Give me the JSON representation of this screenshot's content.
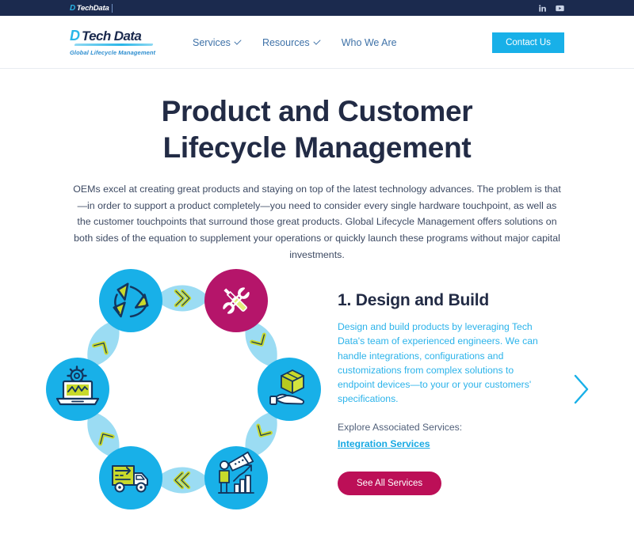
{
  "topbar": {
    "logo_mark": "D",
    "logo_text": "TechData",
    "socials": [
      {
        "name": "linkedin-icon",
        "label": "LinkedIn"
      },
      {
        "name": "youtube-icon",
        "label": "YouTube"
      }
    ]
  },
  "header": {
    "brand_mark": "D",
    "brand_name": "Tech Data",
    "brand_tagline": "Global Lifecycle Management",
    "nav": [
      {
        "label": "Services",
        "has_dropdown": true
      },
      {
        "label": "Resources",
        "has_dropdown": true
      },
      {
        "label": "Who We Are",
        "has_dropdown": false
      }
    ],
    "contact_label": "Contact Us"
  },
  "hero": {
    "title_line1": "Product and Customer",
    "title_line2": "Lifecycle Management",
    "paragraph": "OEMs excel at creating great products and staying on top of the latest technology advances. The problem is that—in order to support a product completely—you need to consider every single hardware touchpoint, as well as the customer touchpoints that surround those great products. Global Lifecycle Management offers solutions on both sides of the equation to supplement your operations or quickly launch these programs without major capital investments."
  },
  "step": {
    "title": "1. Design and Build",
    "body": "Design and build products by leveraging Tech Data's team of experienced engineers. We can handle integrations, configurations and customizations from complex solutions to endpoint devices—to your or your customers' specifications.",
    "explore_label": "Explore Associated Services:",
    "link_label": "Integration Services",
    "see_all_label": "See All Services"
  },
  "cycle": {
    "nodes": [
      {
        "id": "recycle",
        "icon": "recycle-icon",
        "active": false
      },
      {
        "id": "design-build",
        "icon": "tools-icon",
        "active": true
      },
      {
        "id": "deploy",
        "icon": "hand-box-icon",
        "active": false
      },
      {
        "id": "analytics",
        "icon": "telescope-chart-icon",
        "active": false
      },
      {
        "id": "logistics",
        "icon": "delivery-truck-icon",
        "active": false
      },
      {
        "id": "support",
        "icon": "laptop-gear-icon",
        "active": false
      }
    ],
    "connectors": 6
  },
  "carousel": {
    "next_label": "Next"
  },
  "colors": {
    "navy": "#1b2a4e",
    "heading": "#222b45",
    "cyan": "#18b0e8",
    "cyan_light": "#9bdcf3",
    "magenta": "#bc0f57",
    "lime": "#c8d92b",
    "link": "#18a9e3"
  }
}
